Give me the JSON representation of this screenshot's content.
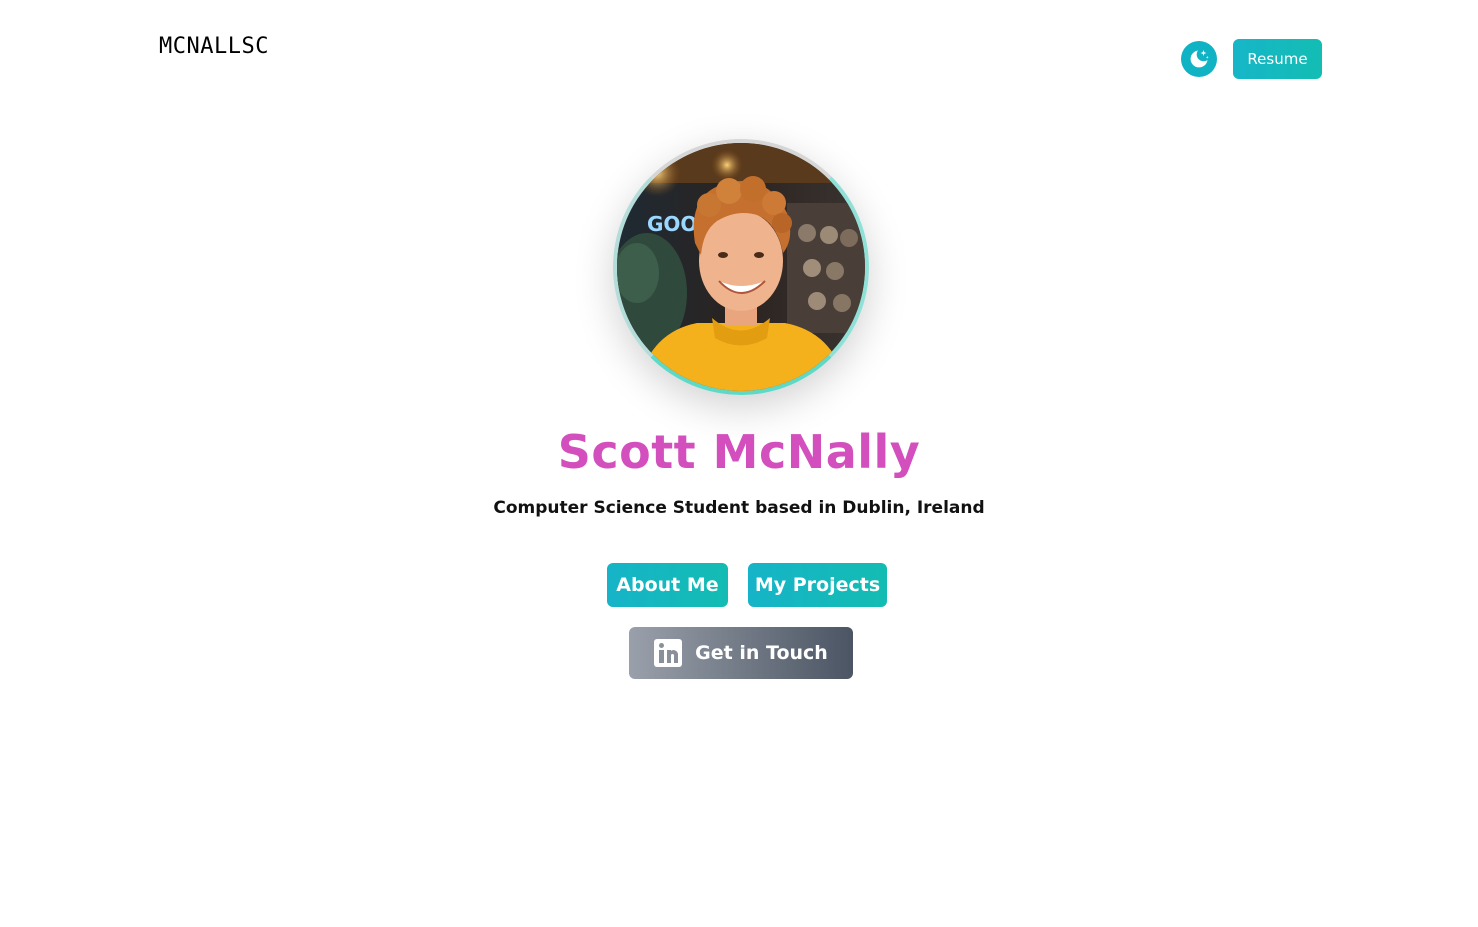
{
  "header": {
    "logo_text": "MCNALLSC",
    "theme_toggle_icon": "moon-stars-icon",
    "resume_label": "Resume"
  },
  "hero": {
    "avatar_alt": "profile-photo",
    "name": "Scott McNally",
    "subtitle": "Computer Science Student based in Dublin, Ireland"
  },
  "actions": {
    "about_label": "About Me",
    "projects_label": "My Projects",
    "contact_label": "Get in Touch",
    "contact_icon": "linkedin-icon"
  },
  "colors": {
    "accent_teal": "#16b6c8",
    "name_pink": "#d24fbd",
    "contact_gradient_start": "#9aa0ab",
    "contact_gradient_end": "#4b5563"
  }
}
